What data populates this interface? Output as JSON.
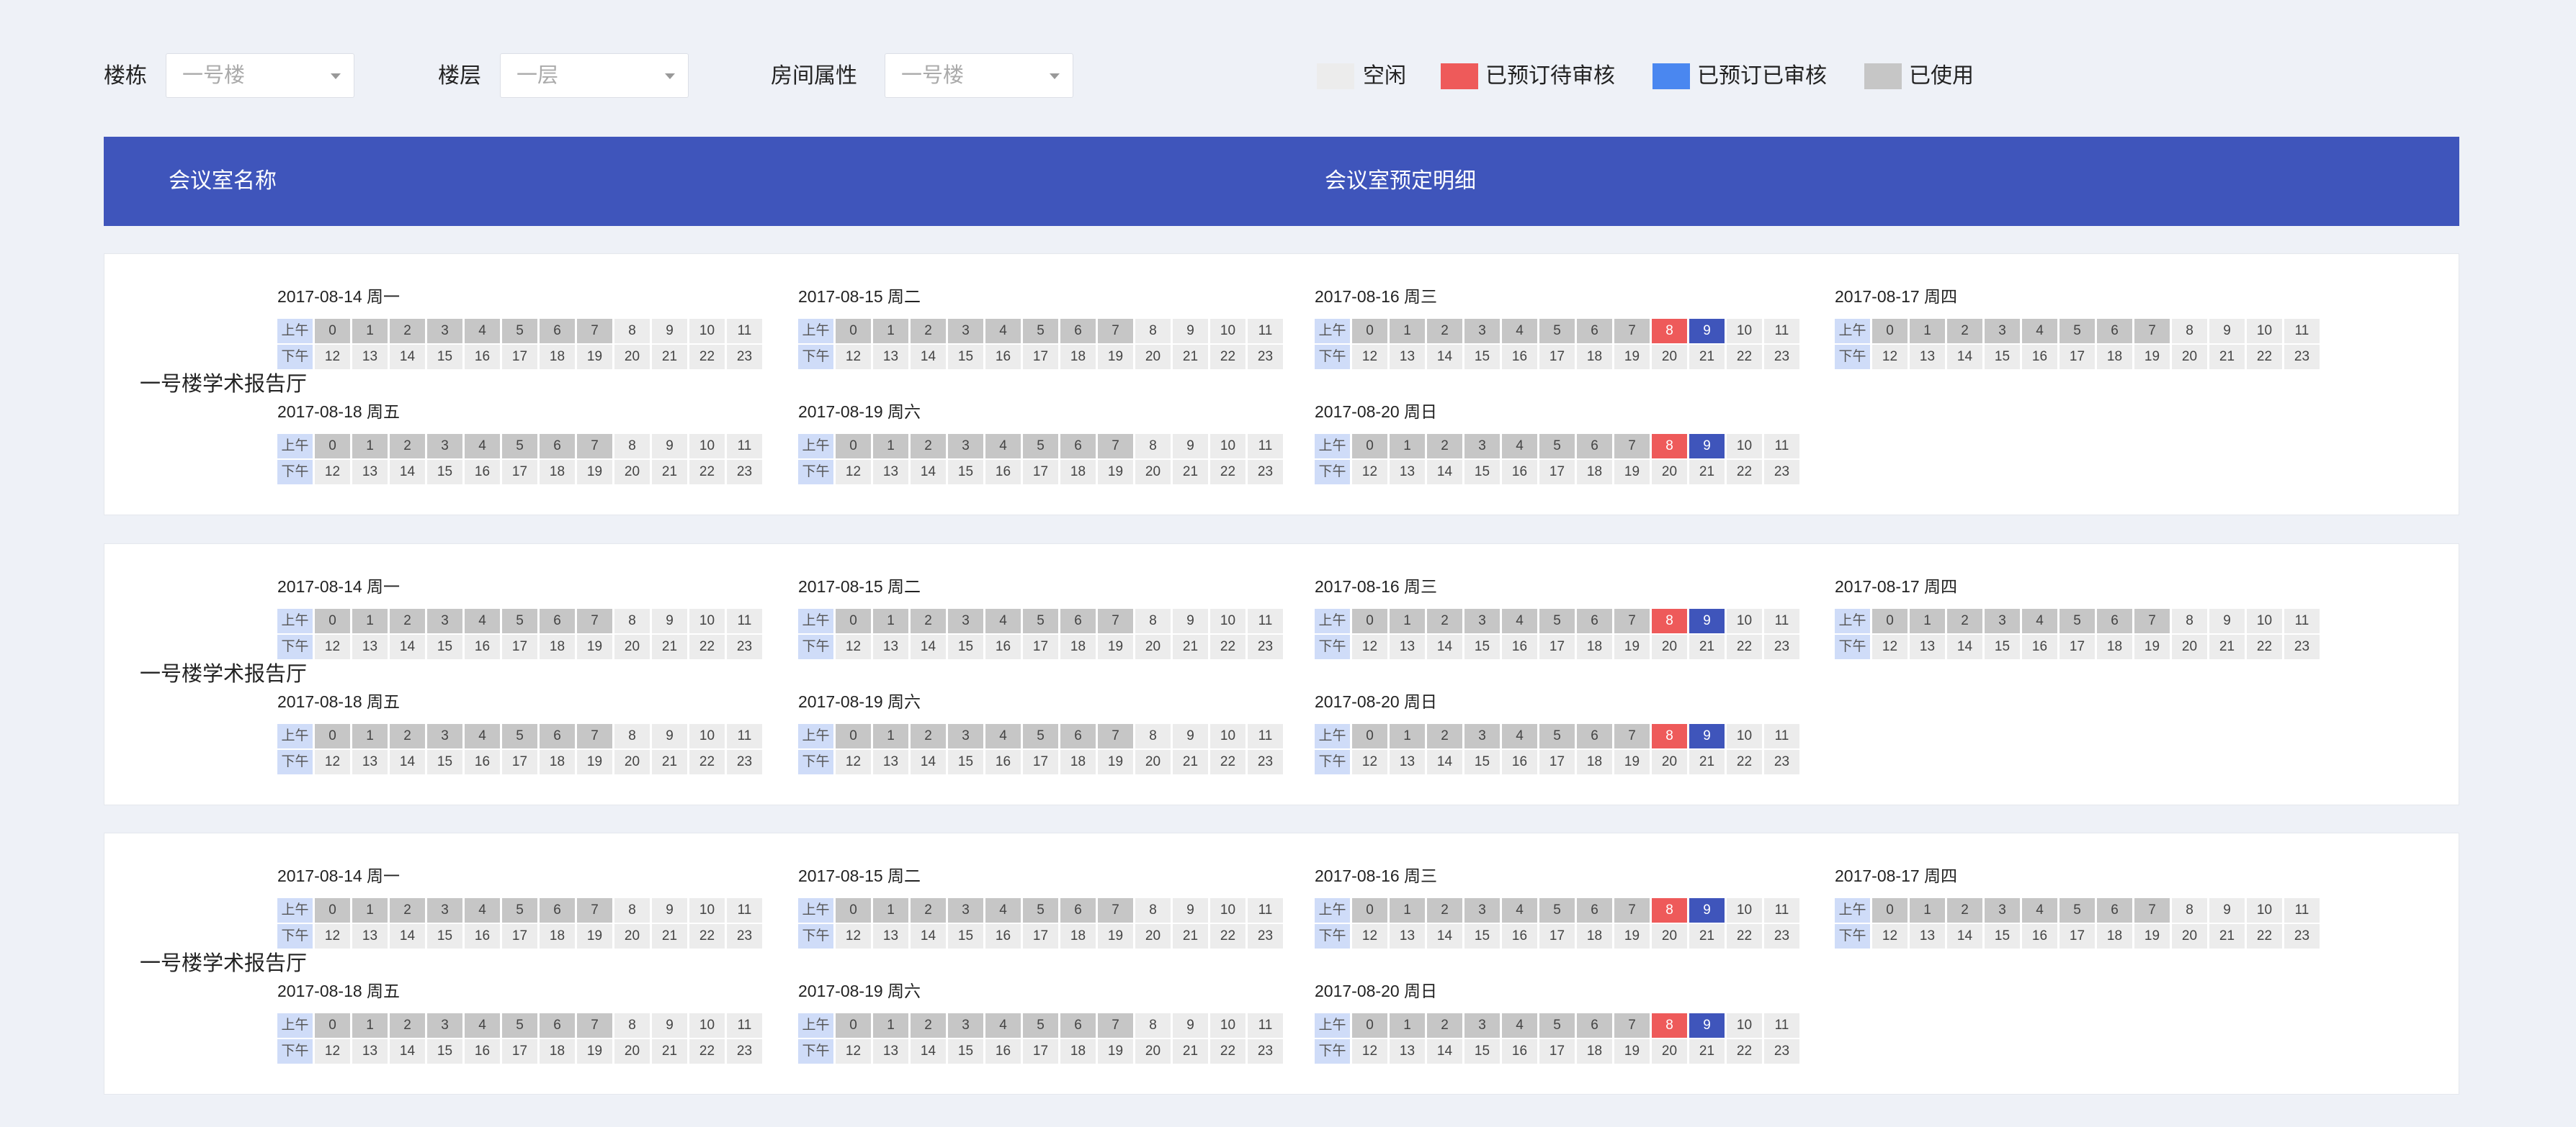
{
  "filters": {
    "building": {
      "label": "楼栋",
      "value": "一号楼"
    },
    "floor": {
      "label": "楼层",
      "value": "一层"
    },
    "attribute": {
      "label": "房间属性",
      "value": "一号楼"
    }
  },
  "legend": [
    {
      "key": "free",
      "label": "空闲",
      "color": "#ececec"
    },
    {
      "key": "pending",
      "label": "已预订待审核",
      "color": "#ee5a5a"
    },
    {
      "key": "approved",
      "label": "已预订已审核",
      "color": "#4a87f0"
    },
    {
      "key": "used",
      "label": "已使用",
      "color": "#c6c6c6"
    }
  ],
  "table_header": {
    "room_col": "会议室名称",
    "detail_col": "会议室预定明细"
  },
  "period_labels": {
    "am": "上午",
    "pm": "下午"
  },
  "rooms": [
    {
      "name": "一号楼学术报告厅",
      "days": [
        {
          "label": "2017-08-14  周一",
          "used": [
            0,
            1,
            2,
            3,
            4,
            5,
            6,
            7
          ],
          "pending": [],
          "approved": []
        },
        {
          "label": "2017-08-15  周二",
          "used": [
            0,
            1,
            2,
            3,
            4,
            5,
            6,
            7
          ],
          "pending": [],
          "approved": []
        },
        {
          "label": "2017-08-16  周三",
          "used": [
            0,
            1,
            2,
            3,
            4,
            5,
            6,
            7
          ],
          "pending": [
            8
          ],
          "approved": [
            9
          ]
        },
        {
          "label": "2017-08-17 周四",
          "used": [
            0,
            1,
            2,
            3,
            4,
            5,
            6,
            7
          ],
          "pending": [],
          "approved": []
        },
        {
          "label": "2017-08-18 周五",
          "used": [
            0,
            1,
            2,
            3,
            4,
            5,
            6,
            7
          ],
          "pending": [],
          "approved": []
        },
        {
          "label": "2017-08-19  周六",
          "used": [
            0,
            1,
            2,
            3,
            4,
            5,
            6,
            7
          ],
          "pending": [],
          "approved": []
        },
        {
          "label": "2017-08-20  周日",
          "used": [
            0,
            1,
            2,
            3,
            4,
            5,
            6,
            7
          ],
          "pending": [
            8
          ],
          "approved": [
            9
          ]
        }
      ]
    },
    {
      "name": "一号楼学术报告厅",
      "days": [
        {
          "label": "2017-08-14  周一",
          "used": [
            0,
            1,
            2,
            3,
            4,
            5,
            6,
            7
          ],
          "pending": [],
          "approved": []
        },
        {
          "label": "2017-08-15  周二",
          "used": [
            0,
            1,
            2,
            3,
            4,
            5,
            6,
            7
          ],
          "pending": [],
          "approved": []
        },
        {
          "label": "2017-08-16  周三",
          "used": [
            0,
            1,
            2,
            3,
            4,
            5,
            6,
            7
          ],
          "pending": [
            8
          ],
          "approved": [
            9
          ]
        },
        {
          "label": "2017-08-17 周四",
          "used": [
            0,
            1,
            2,
            3,
            4,
            5,
            6,
            7
          ],
          "pending": [],
          "approved": []
        },
        {
          "label": "2017-08-18 周五",
          "used": [
            0,
            1,
            2,
            3,
            4,
            5,
            6,
            7
          ],
          "pending": [],
          "approved": []
        },
        {
          "label": "2017-08-19  周六",
          "used": [
            0,
            1,
            2,
            3,
            4,
            5,
            6,
            7
          ],
          "pending": [],
          "approved": []
        },
        {
          "label": "2017-08-20  周日",
          "used": [
            0,
            1,
            2,
            3,
            4,
            5,
            6,
            7
          ],
          "pending": [
            8
          ],
          "approved": [
            9
          ]
        }
      ]
    },
    {
      "name": "一号楼学术报告厅",
      "days": [
        {
          "label": "2017-08-14  周一",
          "used": [
            0,
            1,
            2,
            3,
            4,
            5,
            6,
            7
          ],
          "pending": [],
          "approved": []
        },
        {
          "label": "2017-08-15  周二",
          "used": [
            0,
            1,
            2,
            3,
            4,
            5,
            6,
            7
          ],
          "pending": [],
          "approved": []
        },
        {
          "label": "2017-08-16  周三",
          "used": [
            0,
            1,
            2,
            3,
            4,
            5,
            6,
            7
          ],
          "pending": [
            8
          ],
          "approved": [
            9
          ]
        },
        {
          "label": "2017-08-17 周四",
          "used": [
            0,
            1,
            2,
            3,
            4,
            5,
            6,
            7
          ],
          "pending": [],
          "approved": []
        },
        {
          "label": "2017-08-18 周五",
          "used": [
            0,
            1,
            2,
            3,
            4,
            5,
            6,
            7
          ],
          "pending": [],
          "approved": []
        },
        {
          "label": "2017-08-19  周六",
          "used": [
            0,
            1,
            2,
            3,
            4,
            5,
            6,
            7
          ],
          "pending": [],
          "approved": []
        },
        {
          "label": "2017-08-20  周日",
          "used": [
            0,
            1,
            2,
            3,
            4,
            5,
            6,
            7
          ],
          "pending": [
            8
          ],
          "approved": [
            9
          ]
        }
      ]
    }
  ]
}
